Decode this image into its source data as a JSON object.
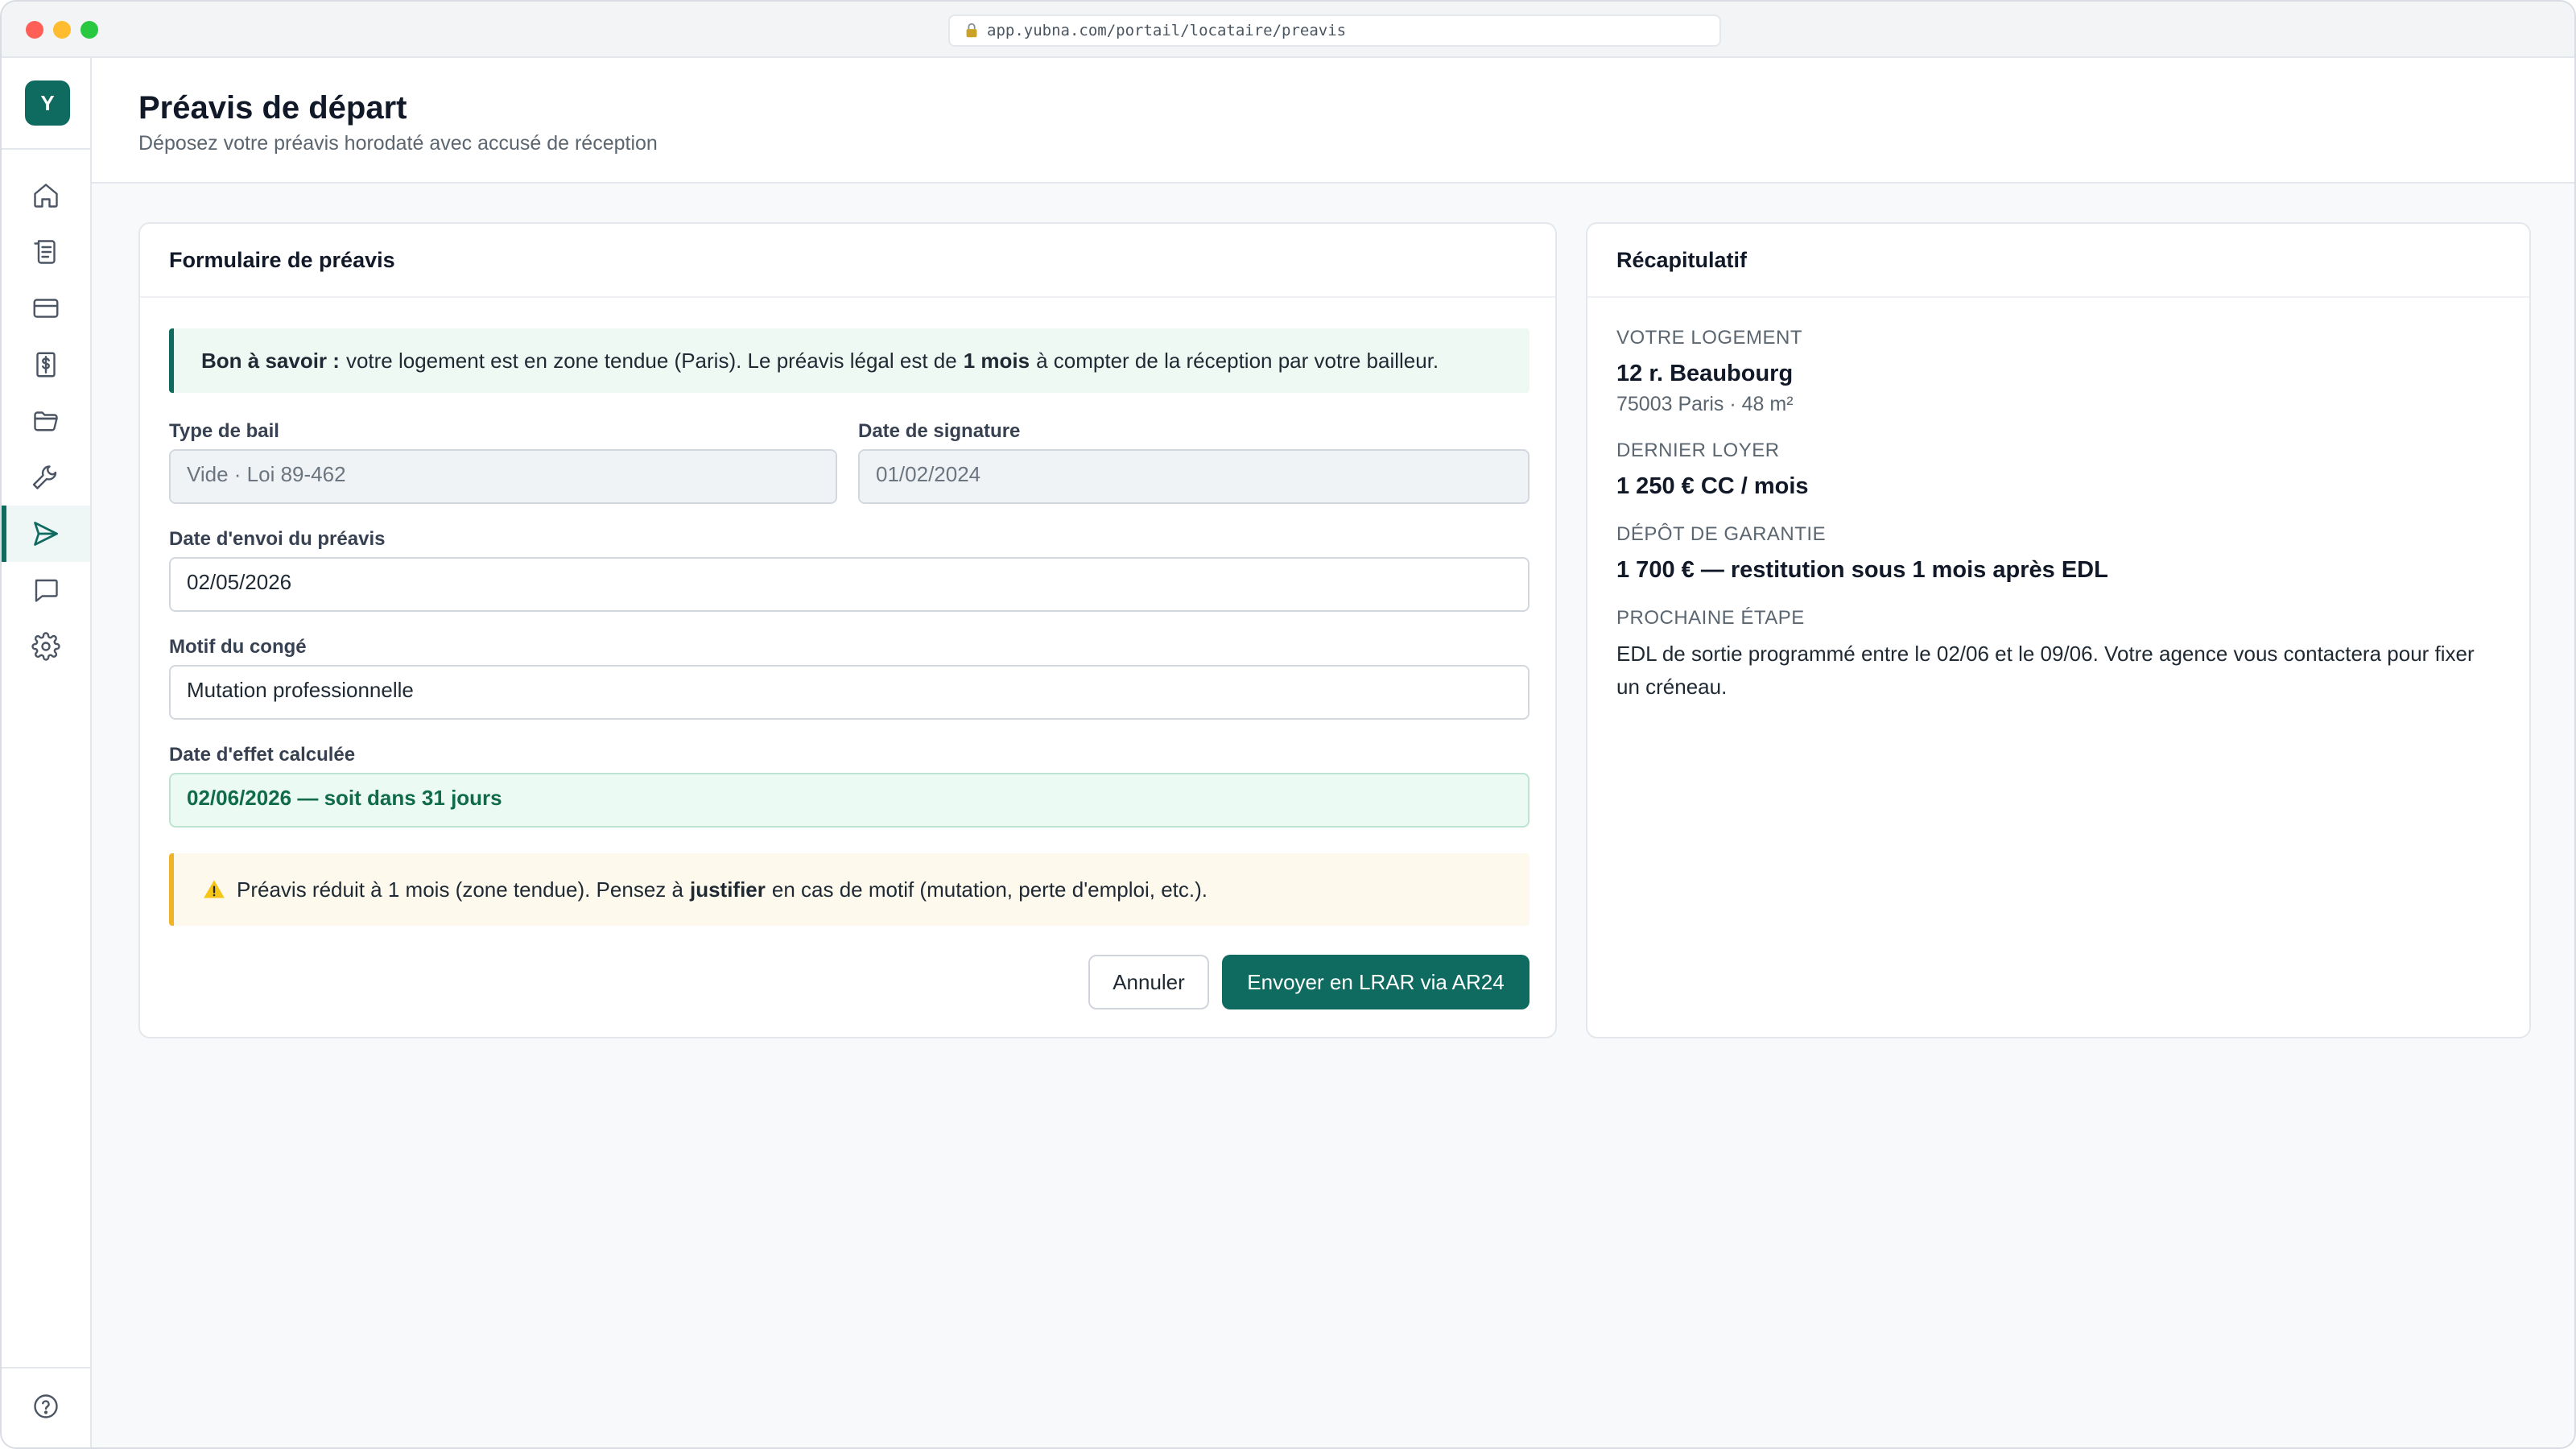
{
  "browser": {
    "url": "app.yubna.com/portail/locataire/preavis"
  },
  "app": {
    "logo_letter": "Y",
    "accent_color": "#0f6b60"
  },
  "sidebar": {
    "items": [
      {
        "icon": "home-icon",
        "active": false
      },
      {
        "icon": "document-icon",
        "active": false
      },
      {
        "icon": "credit-card-icon",
        "active": false
      },
      {
        "icon": "receipt-icon",
        "active": false
      },
      {
        "icon": "folder-icon",
        "active": false
      },
      {
        "icon": "wrench-icon",
        "active": false
      },
      {
        "icon": "send-icon",
        "active": true
      },
      {
        "icon": "message-icon",
        "active": false
      },
      {
        "icon": "gear-icon",
        "active": false
      }
    ],
    "footer_icon": "help-icon"
  },
  "header": {
    "title": "Préavis de départ",
    "subtitle": "Déposez votre préavis horodaté avec accusé de réception"
  },
  "form": {
    "title": "Formulaire de préavis",
    "info": {
      "lead": "Bon à savoir :",
      "text_before": "votre logement est en zone tendue (Paris). Le préavis légal est de",
      "highlight": "1 mois",
      "text_after": "à compter de la réception par votre bailleur."
    },
    "lease_type": {
      "label": "Type de bail",
      "value": "Vide · Loi 89-462"
    },
    "signature_date": {
      "label": "Date de signature",
      "value": "01/02/2024"
    },
    "send_date": {
      "label": "Date d'envoi du préavis",
      "value": "02/05/2026"
    },
    "reason": {
      "label": "Motif du congé",
      "value": "Mutation professionnelle"
    },
    "effective_date": {
      "label": "Date d'effet calculée",
      "value": "02/06/2026 — soit dans 31 jours"
    },
    "warning": {
      "text_before": "Préavis réduit à 1 mois (zone tendue). Pensez à",
      "highlight": "justifier",
      "text_after": "en cas de motif (mutation, perte d'emploi, etc.)."
    },
    "cancel_label": "Annuler",
    "submit_label": "Envoyer en LRAR via AR24"
  },
  "recap": {
    "title": "Récapitulatif",
    "housing_label": "Votre logement",
    "housing_address": "12 r. Beaubourg",
    "housing_details": "75003 Paris · 48 m²",
    "rent_label": "Dernier loyer",
    "rent_value": "1 250 € CC / mois",
    "deposit_label": "Dépôt de garantie",
    "deposit_value": "1 700 € — restitution sous 1 mois après EDL",
    "next_step_label": "Prochaine étape",
    "next_step_text": "EDL de sortie programmé entre le 02/06 et le 09/06. Votre agence vous contactera pour fixer un créneau."
  }
}
